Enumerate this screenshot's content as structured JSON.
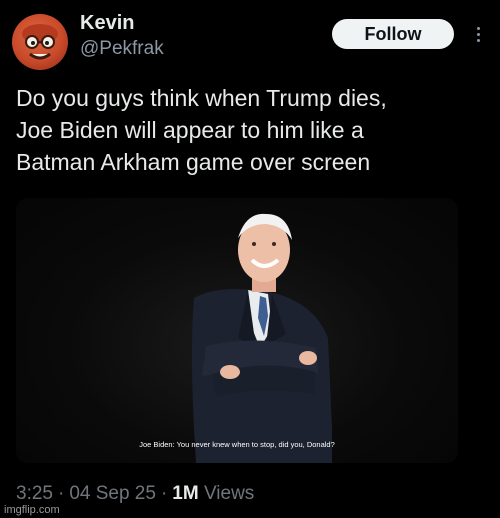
{
  "user": {
    "display_name": "Kevin",
    "handle": "@Pekfrak"
  },
  "follow_button": {
    "label": "Follow"
  },
  "tweet": {
    "lines": [
      "Do you guys think when Trump dies,",
      "Joe Biden will appear to him like a",
      "Batman Arkham game over screen"
    ]
  },
  "media": {
    "subtitle": "Joe Biden: You never knew when to stop, did you, Donald?"
  },
  "meta": {
    "time": "3:25",
    "date": "04 Sep 25",
    "views_count": "1M",
    "views_label": "Views",
    "separator": "·"
  },
  "watermark": {
    "text": "imgflip.com"
  },
  "colors": {
    "background": "#000000",
    "text_primary": "#e7e9ea",
    "text_secondary": "#71767b",
    "follow_bg": "#eff3f4"
  }
}
